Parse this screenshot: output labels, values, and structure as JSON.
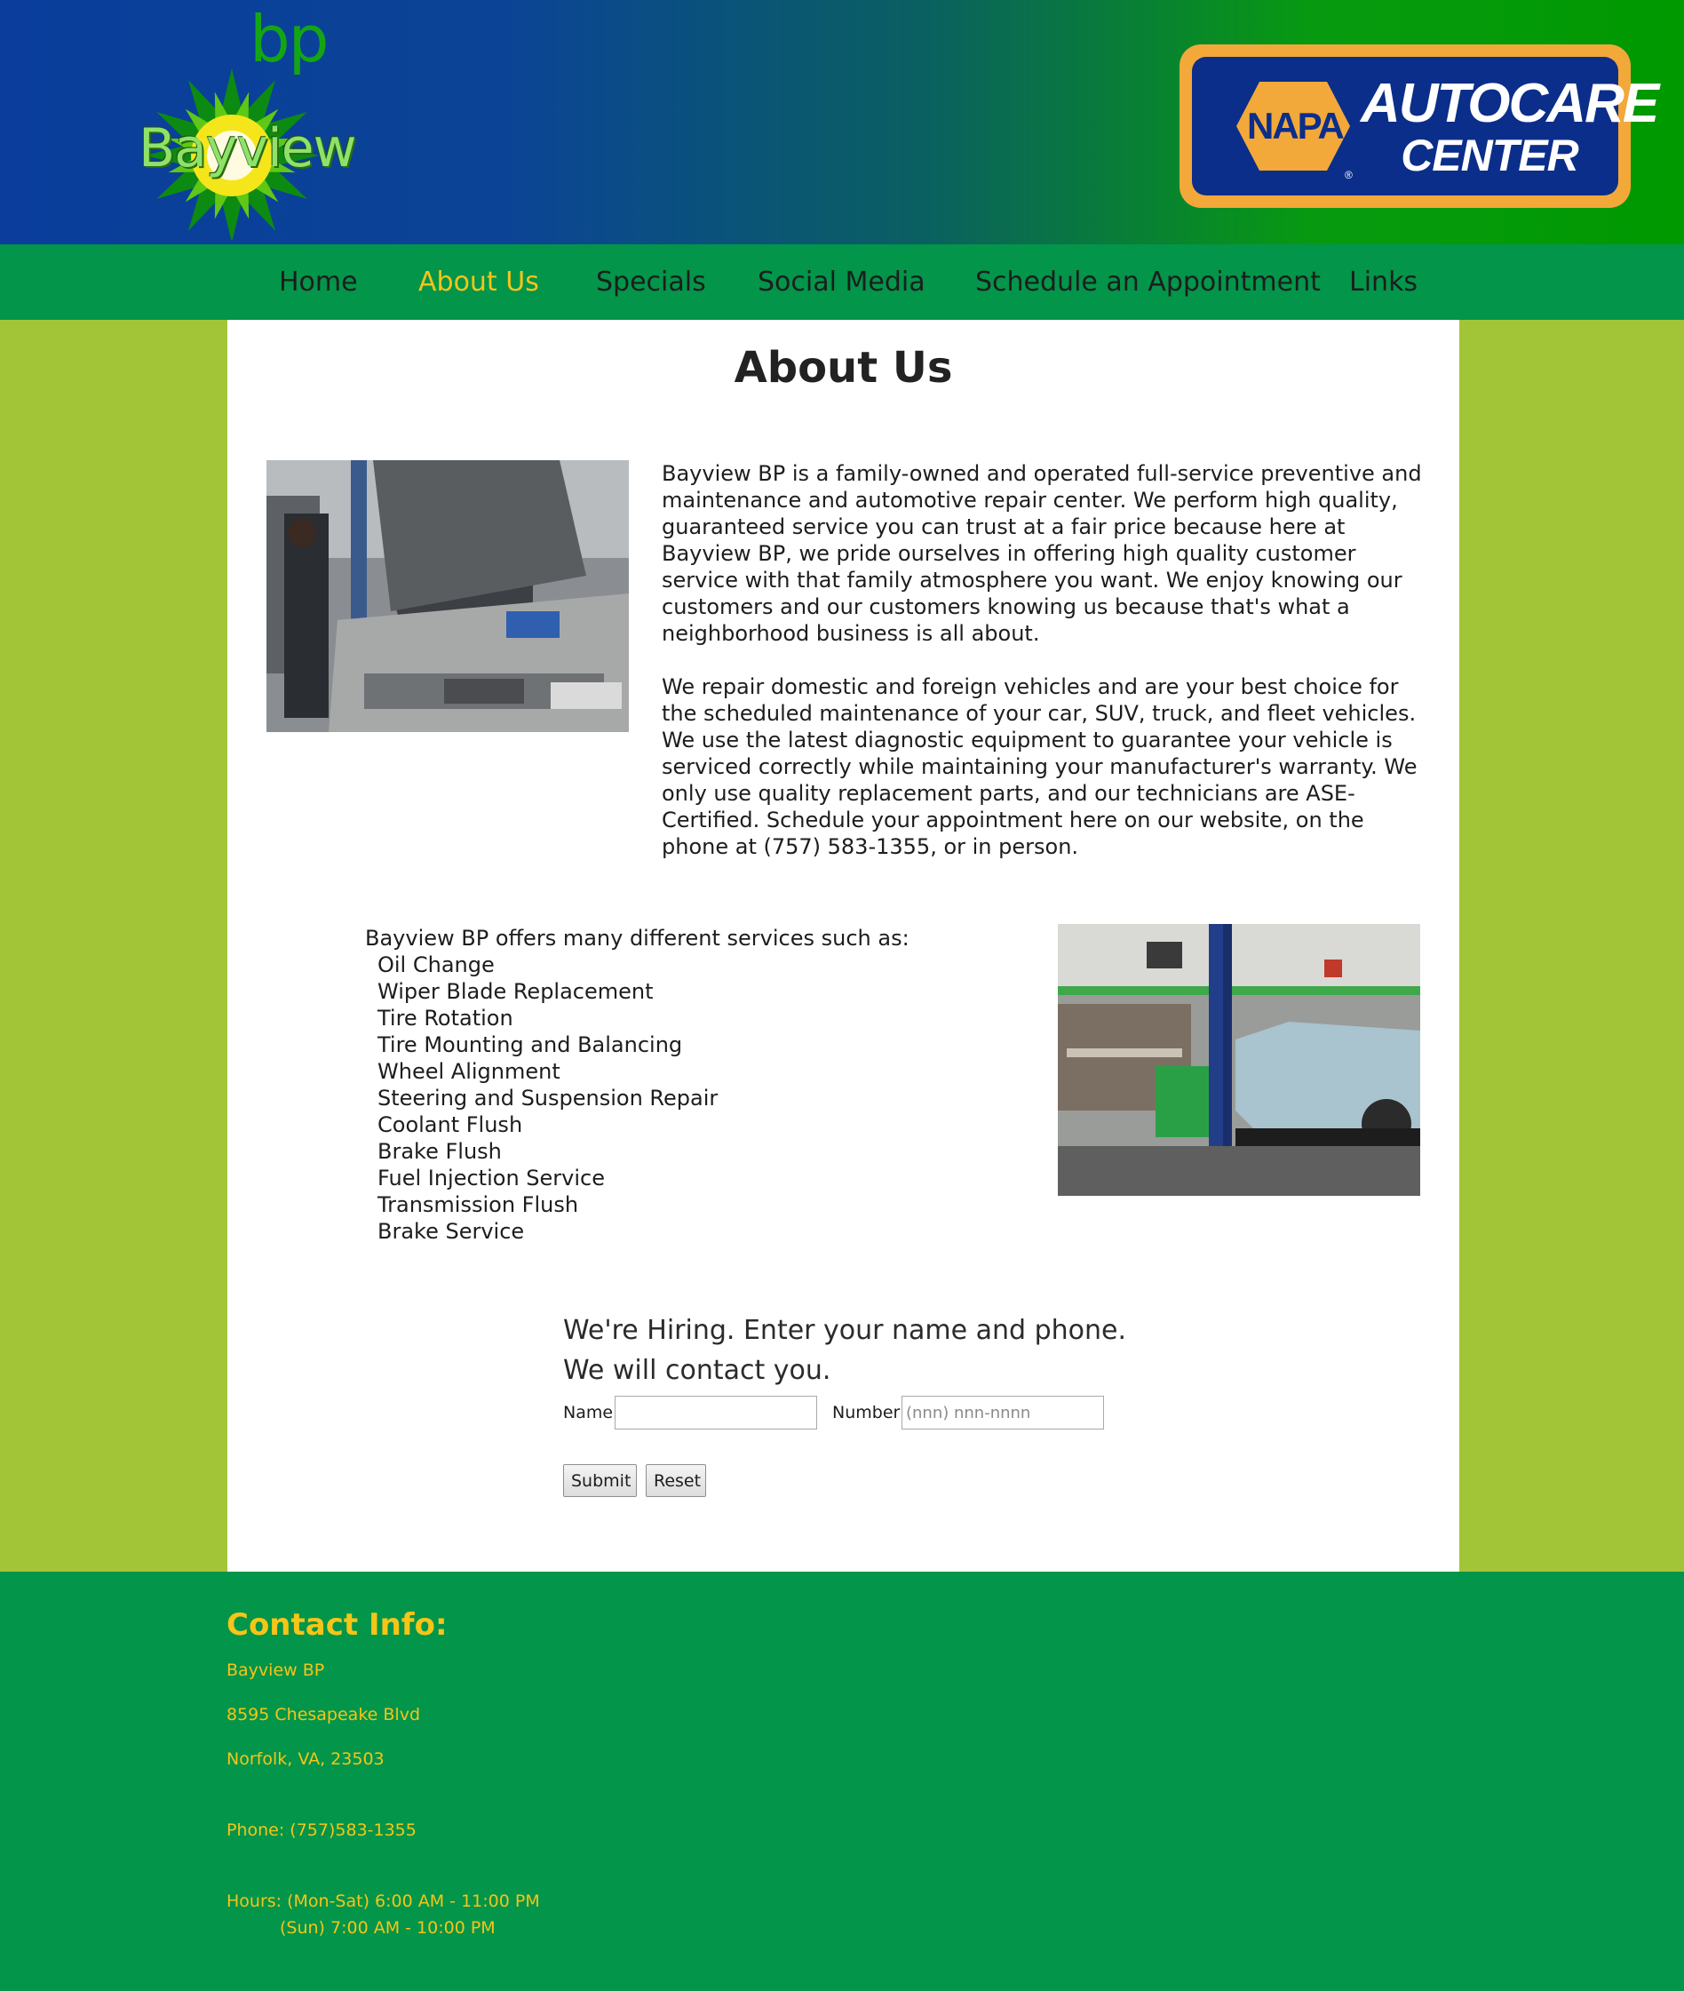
{
  "header": {
    "logo_left": {
      "small_text": "bp",
      "name": "Bayview"
    },
    "logo_right": {
      "napa": "NAPA",
      "autocare": "AUTOCARE",
      "center": "CENTER",
      "reg": "®"
    }
  },
  "nav": {
    "items": [
      {
        "label": "Home",
        "active": false
      },
      {
        "label": "About Us",
        "active": true
      },
      {
        "label": "Specials",
        "active": false
      },
      {
        "label": "Social Media",
        "active": false
      },
      {
        "label": "Schedule an Appointment",
        "active": false
      },
      {
        "label": "Links",
        "active": false
      }
    ]
  },
  "main": {
    "title": "About Us",
    "paragraphs": [
      "Bayview BP is a family-owned and operated full-service preventive and maintenance and automotive repair center. We perform high quality, guaranteed service you can trust at a fair price because here at Bayview BP, we pride ourselves in offering high quality customer service with that family atmosphere you want. We enjoy knowing our customers and our customers knowing us because that's what a neighborhood business is all about.",
      "We repair domestic and foreign vehicles and are your best choice for the scheduled maintenance of your car, SUV, truck, and fleet vehicles. We use the latest diagnostic equipment to guarantee your vehicle is serviced correctly while maintaining your manufacturer's warranty. We only use quality replacement parts, and our technicians are ASE-Certified. Schedule your appointment here on our website, on the phone at (757) 583-1355, or in person."
    ],
    "services": {
      "intro": "Bayview BP offers many different services such as:",
      "items": [
        "Oil Change",
        "Wiper Blade Replacement",
        "Tire Rotation",
        "Tire Mounting and Balancing",
        "Wheel Alignment",
        "Steering and Suspension Repair",
        "Coolant Flush",
        "Brake Flush",
        "Fuel Injection Service",
        "Transmission Flush",
        "Brake Service"
      ]
    },
    "hiring_form": {
      "text": "We're Hiring. Enter your name and phone. We will contact you.",
      "name_label": "Name",
      "name_value": "",
      "number_label": "Number",
      "number_placeholder": "(nnn) nnn-nnnn",
      "submit_label": "Submit",
      "reset_label": "Reset"
    }
  },
  "footer": {
    "heading": "Contact Info:",
    "business_name": "Bayview BP",
    "street": "8595 Chesapeake Blvd",
    "city_line": "Norfolk, VA, 23503",
    "phone": "Phone: (757)583-1355",
    "hours_weekday": "Hours: (Mon-Sat) 6:00 AM - 11:00 PM",
    "hours_sunday": "(Sun) 7:00 AM - 10:00 PM"
  },
  "colors": {
    "nav_bg": "#03954a",
    "page_bg": "#a2c538",
    "accent_yellow": "#f5c518",
    "header_blue": "#0a3d9c",
    "header_green": "#009900"
  }
}
